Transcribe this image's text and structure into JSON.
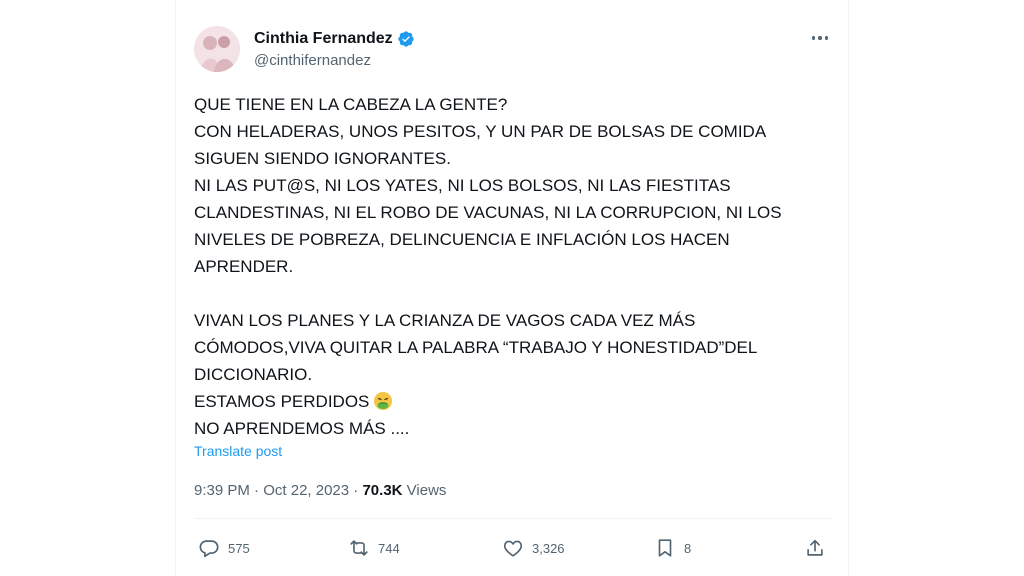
{
  "author": {
    "name": "Cinthia Fernandez",
    "handle": "@cinthifernandez"
  },
  "tweet": {
    "lines": [
      "QUE TIENE EN LA CABEZA LA GENTE?",
      "CON HELADERAS, UNOS PESITOS, Y UN PAR DE BOLSAS DE COMIDA",
      "SIGUEN SIENDO IGNORANTES.",
      "NI LAS PUT@S, NI LOS YATES, NI LOS BOLSOS, NI LAS FIESTITAS",
      "CLANDESTINAS, NI EL ROBO DE VACUNAS, NI LA CORRUPCION, NI LOS",
      "NIVELES DE POBREZA, DELINCUENCIA E INFLACIÓN LOS HACEN",
      "APRENDER.",
      "VIVAN LOS PLANES Y LA CRIANZA DE VAGOS CADA VEZ MÁS",
      "CÓMODOS,VIVA QUITAR LA PALABRA “TRABAJO Y HONESTIDAD”DEL",
      "DICCIONARIO.",
      "ESTAMOS PERDIDOS",
      "NO APRENDEMOS MÁS ...."
    ],
    "emoji_icon": "vomiting-face-emoji",
    "translate_label": "Translate post"
  },
  "meta": {
    "time": "9:39 PM",
    "separator": "·",
    "date": "Oct 22, 2023",
    "views_count": "70.3K",
    "views_label": "Views"
  },
  "actions": {
    "replies": "575",
    "reposts": "744",
    "likes": "3,326",
    "bookmarks": "8"
  },
  "icons": {
    "verified": "verified-badge-icon",
    "more": "more-options-icon",
    "reply": "reply-icon",
    "repost": "repost-icon",
    "like": "like-icon",
    "bookmark": "bookmark-icon",
    "share": "share-icon"
  },
  "colors": {
    "verified_blue": "#1d9bf0",
    "link_blue": "#1d9bf0",
    "secondary_text": "#536471",
    "primary_text": "#0f1419"
  }
}
